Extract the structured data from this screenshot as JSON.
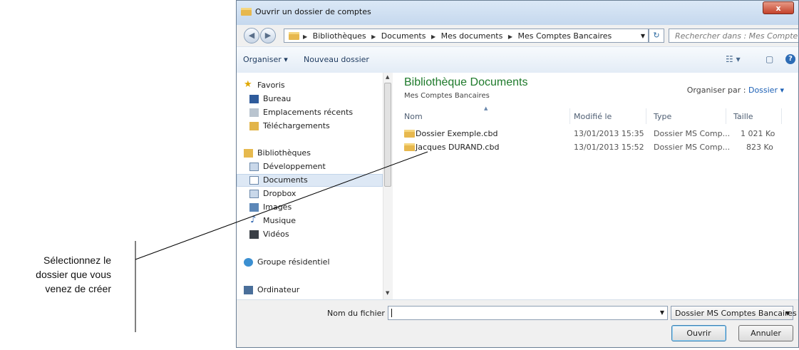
{
  "annotation": {
    "lines": [
      "Sélectionnez le",
      "dossier que vous",
      "venez de créer"
    ]
  },
  "window": {
    "title": "Ouvrir un dossier de comptes",
    "close_label": "x"
  },
  "address": {
    "crumbs": [
      "Bibliothèques",
      "Documents",
      "Mes documents",
      "Mes Comptes Bancaires"
    ],
    "search_placeholder": "Rechercher dans : Mes Compte..."
  },
  "toolbar": {
    "organize_label": "Organiser ▾",
    "new_folder_label": "Nouveau dossier",
    "help_label": "?"
  },
  "sidebar": {
    "favorites": "Favoris",
    "bureau": "Bureau",
    "recent": "Emplacements récents",
    "downloads": "Téléchargements",
    "libraries": "Bibliothèques",
    "dev": "Développement",
    "documents": "Documents",
    "dropbox": "Dropbox",
    "images": "Images",
    "music": "Musique",
    "videos": "Vidéos",
    "homegroup": "Groupe résidentiel",
    "computer": "Ordinateur"
  },
  "content": {
    "library_title": "Bibliothèque Documents",
    "library_subtitle": "Mes Comptes Bancaires",
    "arrange_label": "Organiser par :",
    "arrange_value": "Dossier ▾",
    "columns": {
      "name": "Nom",
      "modified": "Modifié le",
      "type": "Type",
      "size": "Taille"
    },
    "files": [
      {
        "name": "Dossier Exemple.cbd",
        "modified": "13/01/2013 15:35",
        "type": "Dossier MS Comp...",
        "size": "1 021 Ko"
      },
      {
        "name": "Jacques DURAND.cbd",
        "modified": "13/01/2013 15:52",
        "type": "Dossier MS Comp...",
        "size": "823 Ko"
      }
    ]
  },
  "bottom": {
    "filename_label": "Nom du fichier :",
    "filename_value": "",
    "filetype_value": "Dossier MS Comptes Bancaires",
    "open_label": "Ouvrir",
    "cancel_label": "Annuler"
  }
}
